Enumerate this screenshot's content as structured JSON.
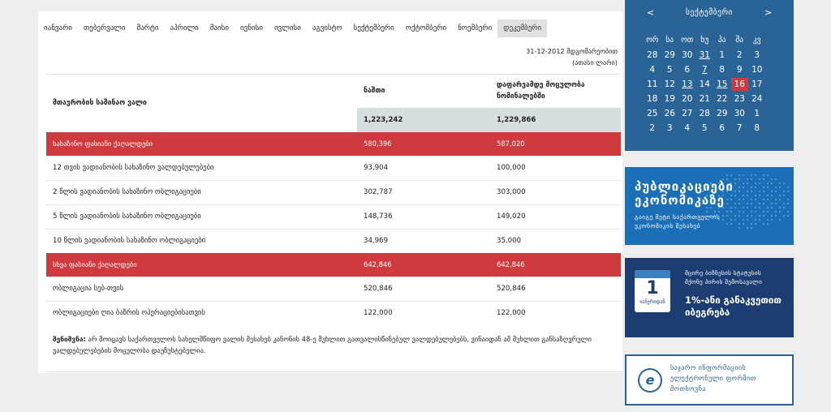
{
  "months": [
    "იანვარი",
    "თებერვალი",
    "მარტი",
    "აპრილი",
    "მაისი",
    "ივნისი",
    "ივლისი",
    "აგვისტო",
    "სექტემბერი",
    "ოქტომბერი",
    "ნოემბერი",
    "დეკემბერი"
  ],
  "active_month": "დეკემბერი",
  "table": {
    "date_line1": "31-12-2012 მდგომარეობით",
    "date_line2": "(ათასი ლარი)",
    "header_label": "მთავრობის საშინაო ვალი",
    "col1_header": "ნაშთი",
    "col2_header_line1": "დაფარვამდე მოცულობა",
    "col2_header_line2": "ნომინალებში",
    "total_col1": "1,223,242",
    "total_col2": "1,229,866",
    "rows": [
      {
        "label": "სახაზინო ფასიანი ქაღალდები",
        "col1": "580,396",
        "col2": "587,020"
      },
      {
        "label": "12 თვის ვადიანობის სახაზინო ვალდებულებები",
        "col1": "93,904",
        "col2": "100,000"
      },
      {
        "label": "2 წლის ვადიანობის სახაზინო ობლიგაციები",
        "col1": "302,787",
        "col2": "303,000"
      },
      {
        "label": "5 წლის ვადიანობის სახაზინო ობლიგაციები",
        "col1": "148,736",
        "col2": "149,020"
      },
      {
        "label": "10 წლის ვადიანობის სახაზინო ობლიგაციები",
        "col1": "34,969",
        "col2": "35,000"
      },
      {
        "label": "სხვა ფასიანი ქაღალდები",
        "col1": "642,846",
        "col2": "642,846"
      },
      {
        "label": "ობლიგაცია სებ-თვის",
        "col1": "520,846",
        "col2": "520,846"
      },
      {
        "label": "ობლიგაციები ღია ბაზრის ოპერაციებისათვის",
        "col1": "122,000",
        "col2": "122,000"
      }
    ]
  },
  "note": {
    "bold": "შენიშვნა:",
    "text": " არ მოიცავს საქართველოს სახელმწიფო ვალის შესახებ კანონის 48-ე მუხლით გათვალისწინებულ ვალდებულებებს, ვინაიდან ამ მუხლით განსაზღვრული ვალდებულებების მოცულობა დაუზუსტებელია."
  },
  "calendar": {
    "title": "სექტემბერი",
    "prev": "<",
    "next": ">",
    "weekdays": [
      "ორ",
      "სა",
      "ოთ",
      "ხუ",
      "პა",
      "შა",
      "კვ"
    ],
    "weeks": [
      [
        "28",
        "29",
        "30",
        "31",
        "1",
        "2",
        "3"
      ],
      [
        "4",
        "5",
        "6",
        "7",
        "8",
        "9",
        "10"
      ],
      [
        "11",
        "12",
        "13",
        "14",
        "15",
        "16",
        "17"
      ],
      [
        "18",
        "19",
        "20",
        "21",
        "22",
        "23",
        "24"
      ],
      [
        "25",
        "26",
        "27",
        "28",
        "29",
        "30",
        "1"
      ],
      [
        "2",
        "3",
        "4",
        "5",
        "6",
        "7",
        "8"
      ]
    ],
    "today": "16",
    "underlined": [
      "31",
      "7",
      "13",
      "15"
    ]
  },
  "banner1": {
    "title_line1": "პუბლიკაციები",
    "title_line2": "ეკონომიკაზე",
    "sub_line1": "გაიგე მეტი საქართველოს",
    "sub_line2": "ეკონომიკის შესახებ"
  },
  "banner2": {
    "cal_number": "1",
    "cal_label": "იანვრიდან",
    "text_line1": "მცირე ბიზნესის სტატუსის",
    "text_line2": "მქონე პირის შემოსავალი",
    "big_line1": "1%-ანი განაკვეთით",
    "big_line2": "იბეგრება"
  },
  "banner3": {
    "icon": "e",
    "line1": "საჯარო ინფორმაციის",
    "line2": "ელექტრონული ფორმით",
    "line3": "მოთხოვნა"
  },
  "colors": {
    "red_row": "#cf3a3f",
    "calendar_bg": "#2a6496",
    "total_bg": "#d7dedf"
  }
}
